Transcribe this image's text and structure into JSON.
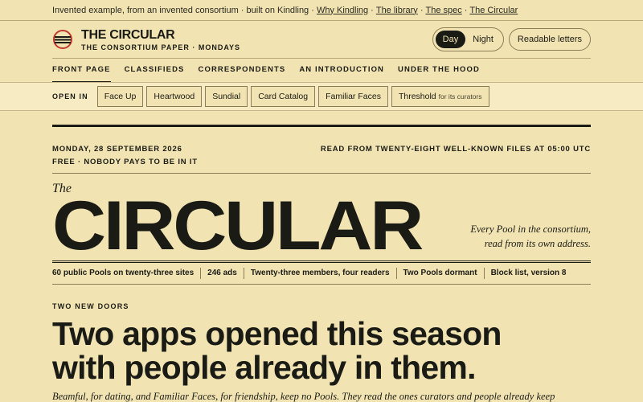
{
  "topbar": {
    "intro": "Invented example, from an invented consortium · built on Kindling ·",
    "links": [
      "Why Kindling",
      "The library",
      "The spec",
      "The Circular"
    ]
  },
  "brand": {
    "title": "THE CIRCULAR",
    "subtitle": "THE CONSORTIUM PAPER · MONDAYS"
  },
  "controls": {
    "day": "Day",
    "night": "Night",
    "readable": "Readable letters",
    "mode_selected": "Day"
  },
  "nav": [
    "FRONT PAGE",
    "CLASSIFIEDS",
    "CORRESPONDENTS",
    "AN INTRODUCTION",
    "UNDER THE HOOD"
  ],
  "open_in": {
    "label": "OPEN IN",
    "apps": [
      "Face Up",
      "Heartwood",
      "Sundial",
      "Card Catalog",
      "Familiar Faces"
    ],
    "threshold": "Threshold",
    "threshold_note": "for its curators"
  },
  "paper": {
    "date": "MONDAY, 28 SEPTEMBER 2026",
    "price": "FREE · NOBODY PAYS TO BE IN IT",
    "source": "READ FROM TWENTY-EIGHT WELL-KNOWN FILES AT 05:00 UTC",
    "the": "The",
    "title": "CIRCULAR",
    "tagline1": "Every Pool in the consortium,",
    "tagline2": "read from its own address.",
    "stats": [
      "60 public Pools on twenty-three sites",
      "246 ads",
      "Twenty-three members, four readers",
      "Two Pools dormant",
      "Block list, version 8"
    ],
    "kicker": "TWO NEW DOORS",
    "headline1": "Two apps opened this season",
    "headline2": "with people already in them.",
    "dek": "Beamful, for dating, and Familiar Faces, for friendship, keep no Pools. They read the ones curators and people already keep"
  },
  "colors": {
    "background": "#f2e4b2",
    "ink": "#1b1b16",
    "logo_red": "#c0392b"
  }
}
